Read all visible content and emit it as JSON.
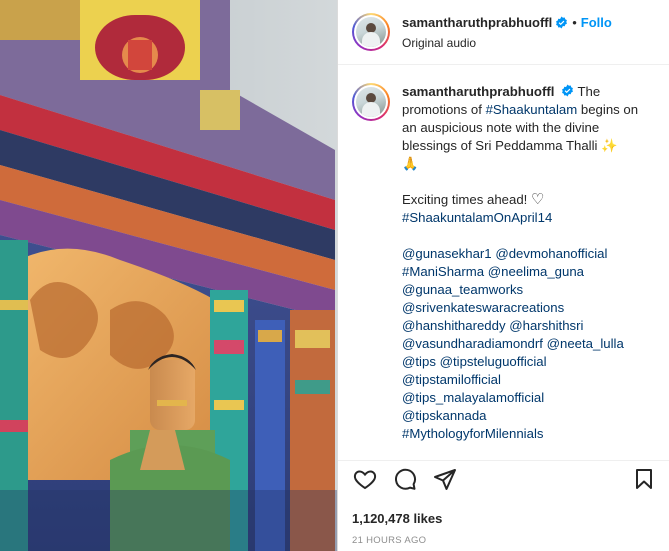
{
  "header": {
    "username": "samantharuthprabhuoffl",
    "separator": "•",
    "follow_label": "Follo",
    "subtitle": "Original audio"
  },
  "caption": {
    "username": "samantharuthprabhuoffl",
    "text_part1": "The promotions of ",
    "hashtag1": "#Shaakuntalam",
    "text_part2": " begins on an auspicious note with the divine blessings of Sri Peddamma Thalli ",
    "emoji1": "✨",
    "emoji2": "🙏",
    "line_exciting": "Exciting times ahead! ",
    "heart_emoji": "♡",
    "hashtag2": "#ShaakuntalamOnApril14",
    "mentions": [
      [
        "@gunasekhar1",
        "@devmohanofficial"
      ],
      [
        "#ManiSharma",
        "@neelima_guna"
      ],
      [
        "@gunaa_teamworks"
      ],
      [
        "@srivenkateswaracreations"
      ],
      [
        "@hanshithareddy",
        "@harshithsri"
      ],
      [
        "@vasundharadiamondrf",
        "@neeta_lulla"
      ],
      [
        "@tips",
        "@tipsteluguofficial"
      ],
      [
        "@tipstamilofficial"
      ],
      [
        "@tips_malayalamofficial"
      ],
      [
        "@tipskannada"
      ],
      [
        "#MythologyforMilennials"
      ]
    ]
  },
  "stats": {
    "likes": "1,120,478 likes",
    "time_ago": "21 HOURS AGO"
  },
  "icons": {
    "like": "heart-icon",
    "comment": "comment-icon",
    "share": "share-icon",
    "save": "bookmark-icon",
    "verified": "verified-badge-icon"
  },
  "colors": {
    "link": "#00376b",
    "follow": "#0095f6",
    "verified": "#0095f6",
    "muted": "#8e8e8e"
  }
}
